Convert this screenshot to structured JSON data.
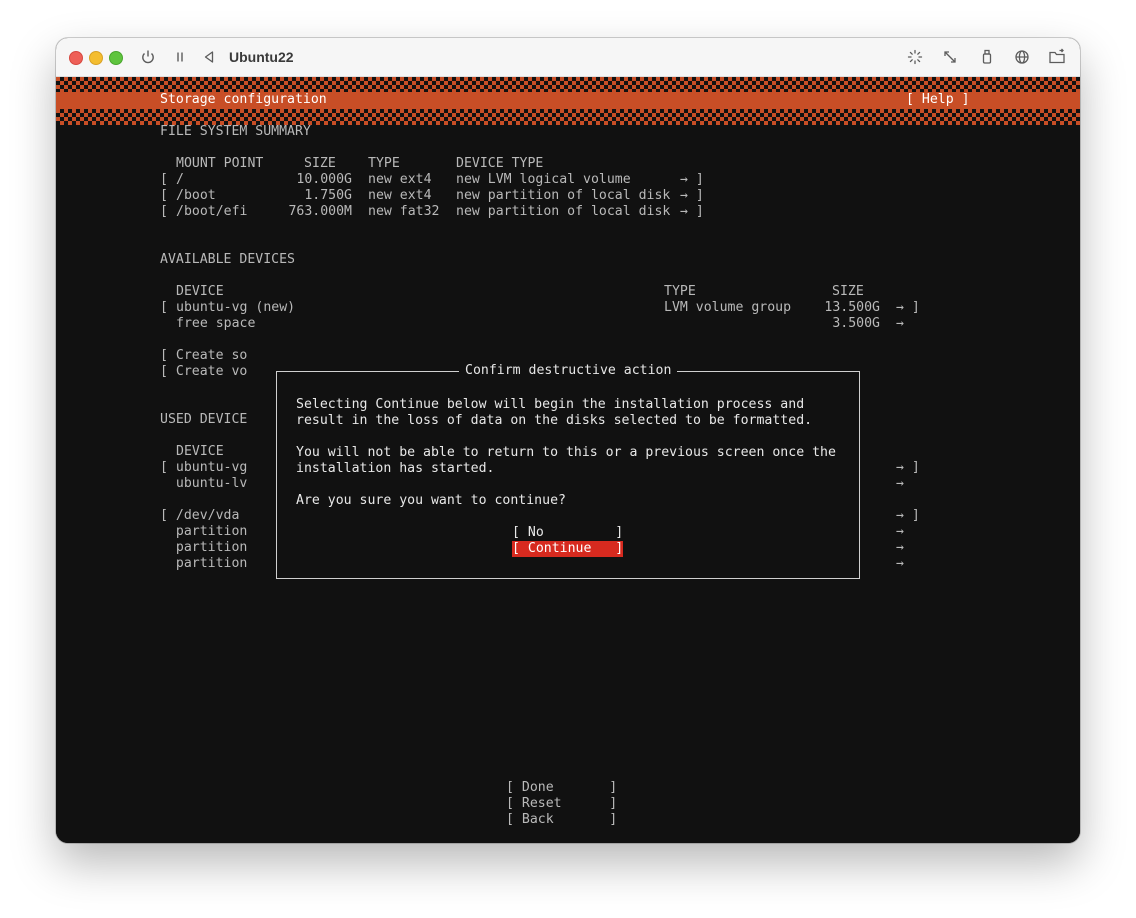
{
  "window": {
    "title": "Ubuntu22"
  },
  "icons": [
    "power-icon",
    "pause-icon",
    "back-icon",
    "brightness-icon",
    "resize-icon",
    "usb-icon",
    "network-icon",
    "folder-icon"
  ],
  "colors": {
    "accent": "#c84e26",
    "selected": "#d72a1f",
    "background": "#111111",
    "text": "#b9b9b9"
  },
  "header": {
    "title": "Storage configuration",
    "help": "[ Help ]"
  },
  "fs_summary": {
    "heading": "FILE SYSTEM SUMMARY",
    "columns": [
      "MOUNT POINT",
      "SIZE",
      "TYPE",
      "DEVICE TYPE"
    ],
    "rows": [
      {
        "bracket": "[",
        "mount": "/",
        "size": "10.000G",
        "type": "new ext4",
        "device_type": "new LVM logical volume",
        "end": "→ ]"
      },
      {
        "bracket": "[",
        "mount": "/boot",
        "size": "1.750G",
        "type": "new ext4",
        "device_type": "new partition of local disk",
        "end": "→ ]"
      },
      {
        "bracket": "[",
        "mount": "/boot/efi",
        "size": "763.000M",
        "type": "new fat32",
        "device_type": "new partition of local disk",
        "end": "→ ]"
      }
    ]
  },
  "available": {
    "heading": "AVAILABLE DEVICES",
    "columns": [
      "DEVICE",
      "TYPE",
      "SIZE"
    ],
    "rows": [
      {
        "bracket": "[",
        "device": "ubuntu-vg (new)",
        "type": "LVM volume group",
        "size": "13.500G",
        "end": "→ ]"
      },
      {
        "bracket": "",
        "device": "free space",
        "type": "",
        "size": "3.500G",
        "end": "→"
      }
    ],
    "actions": [
      "[ Create so",
      "[ Create vo"
    ]
  },
  "used": {
    "heading": "USED DEVICE",
    "column": "DEVICE",
    "rows": [
      {
        "text": "[ ubuntu-vg",
        "end": "→ ]"
      },
      {
        "text": "  ubuntu-lv",
        "end": "→"
      },
      {
        "text": "[ /dev/vda",
        "end": "→ ]"
      },
      {
        "text": "  partition",
        "end": "→"
      },
      {
        "text": "  partition",
        "end": "→"
      },
      {
        "text": "  partition",
        "end": "→"
      }
    ]
  },
  "dialog": {
    "title": "Confirm destructive action",
    "para1_line1": "Selecting Continue below will begin the installation process and",
    "para1_line2": "result in the loss of data on the disks selected to be formatted.",
    "para2_line1": "You will not be able to return to this or a previous screen once the",
    "para2_line2": "installation has started.",
    "question": "Are you sure you want to continue?",
    "buttons": [
      "[ No         ]",
      "[ Continue   ]"
    ]
  },
  "footer_buttons": [
    "[ Done       ]",
    "[ Reset      ]",
    "[ Back       ]"
  ]
}
